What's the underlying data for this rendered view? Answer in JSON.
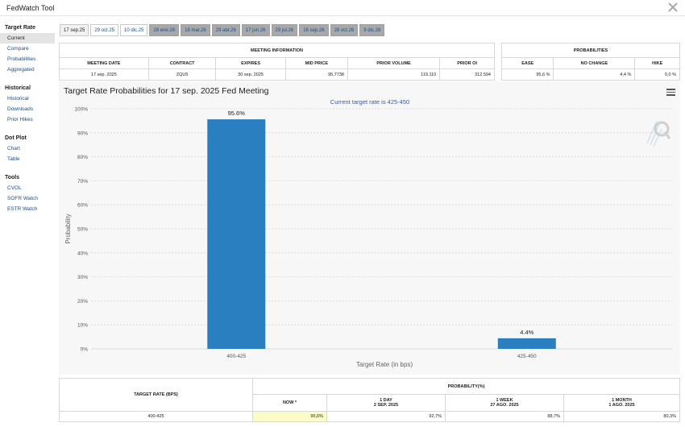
{
  "app": {
    "title": "FedWatch Tool"
  },
  "sidebar": {
    "sections": [
      {
        "heading": "Target Rate",
        "items": [
          {
            "label": "Current",
            "active": true
          },
          {
            "label": "Compare",
            "active": false
          },
          {
            "label": "Probabilities",
            "active": false
          },
          {
            "label": "Aggregated",
            "active": false
          }
        ]
      },
      {
        "heading": "Historical",
        "items": [
          {
            "label": "Historical",
            "active": false
          },
          {
            "label": "Downloads",
            "active": false
          },
          {
            "label": "Prior Hikes",
            "active": false
          }
        ]
      },
      {
        "heading": "Dot Plot",
        "items": [
          {
            "label": "Chart",
            "active": false
          },
          {
            "label": "Table",
            "active": false
          }
        ]
      },
      {
        "heading": "Tools",
        "items": [
          {
            "label": "CVOL",
            "active": false
          },
          {
            "label": "SOFR Watch",
            "active": false
          },
          {
            "label": "ESTR Watch",
            "active": false
          }
        ]
      }
    ]
  },
  "tabs": [
    {
      "label": "17 sep.25",
      "style": "light"
    },
    {
      "label": "29 oct.25",
      "style": "white"
    },
    {
      "label": "10 dic.25",
      "style": "white"
    },
    {
      "label": "28 ene.26",
      "style": "dark"
    },
    {
      "label": "18 mar.26",
      "style": "dark"
    },
    {
      "label": "29 abr.26",
      "style": "dark"
    },
    {
      "label": "17 jun.26",
      "style": "dark"
    },
    {
      "label": "29 jul.26",
      "style": "dark"
    },
    {
      "label": "16 sep.26",
      "style": "dark"
    },
    {
      "label": "28 oct.26",
      "style": "dark"
    },
    {
      "label": "9 dic.26",
      "style": "dark"
    }
  ],
  "meeting_info": {
    "title": "MEETING INFORMATION",
    "headers": [
      "MEETING DATE",
      "CONTRACT",
      "EXPIRES",
      "MID PRICE",
      "PRIOR VOLUME",
      "PRIOR OI"
    ],
    "row": [
      "17 sep. 2025",
      "ZQU5",
      "30 sep. 2025",
      "95,7738",
      "119.110",
      "312.594"
    ]
  },
  "probabilities": {
    "title": "PROBABILITIES",
    "headers": [
      "EASE",
      "NO CHANGE",
      "HIKE"
    ],
    "row": [
      "95,6 %",
      "4,4 %",
      "0,0 %"
    ]
  },
  "chart": {
    "title": "Target Rate Probabilities for 17 sep. 2025 Fed Meeting",
    "subtitle": "Current target rate is 425-450",
    "bar_color": "#2a7fc1"
  },
  "chart_data": {
    "type": "bar",
    "title": "Target Rate Probabilities for 17 sep. 2025 Fed Meeting",
    "subtitle": "Current target rate is 425-450",
    "categories": [
      "400-425",
      "425-450"
    ],
    "values": [
      95.6,
      4.4
    ],
    "data_labels": [
      "95.6%",
      "4.4%"
    ],
    "xlabel": "Target Rate (in bps)",
    "ylabel": "Probability",
    "ylim": [
      0,
      100
    ],
    "yticks": [
      "0%",
      "10%",
      "20%",
      "30%",
      "40%",
      "50%",
      "60%",
      "70%",
      "80%",
      "90%",
      "100%"
    ],
    "grid": true,
    "legend": "none"
  },
  "bottom_table": {
    "target_rate_header": "TARGET RATE (BPS)",
    "probability_header": "PROBABILITY(%)",
    "columns": [
      {
        "line1": "NOW *",
        "line2": ""
      },
      {
        "line1": "1 DAY",
        "line2": "2 SEP. 2025"
      },
      {
        "line1": "1 WEEK",
        "line2": "27 AGO. 2025"
      },
      {
        "line1": "1 MONTH",
        "line2": "1 AGO. 2025"
      }
    ],
    "rows": [
      {
        "rate": "400-425",
        "values": [
          "95,6%",
          "92,7%",
          "88,7%",
          "80,3%"
        ]
      }
    ]
  }
}
